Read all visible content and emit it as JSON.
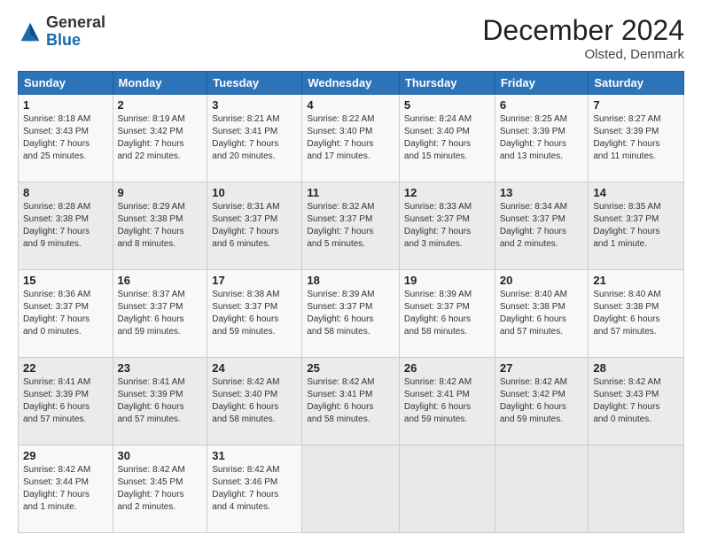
{
  "header": {
    "logo_general": "General",
    "logo_blue": "Blue",
    "month_title": "December 2024",
    "location": "Olsted, Denmark"
  },
  "days_of_week": [
    "Sunday",
    "Monday",
    "Tuesday",
    "Wednesday",
    "Thursday",
    "Friday",
    "Saturday"
  ],
  "weeks": [
    [
      {
        "day": "1",
        "info": "Sunrise: 8:18 AM\nSunset: 3:43 PM\nDaylight: 7 hours\nand 25 minutes."
      },
      {
        "day": "2",
        "info": "Sunrise: 8:19 AM\nSunset: 3:42 PM\nDaylight: 7 hours\nand 22 minutes."
      },
      {
        "day": "3",
        "info": "Sunrise: 8:21 AM\nSunset: 3:41 PM\nDaylight: 7 hours\nand 20 minutes."
      },
      {
        "day": "4",
        "info": "Sunrise: 8:22 AM\nSunset: 3:40 PM\nDaylight: 7 hours\nand 17 minutes."
      },
      {
        "day": "5",
        "info": "Sunrise: 8:24 AM\nSunset: 3:40 PM\nDaylight: 7 hours\nand 15 minutes."
      },
      {
        "day": "6",
        "info": "Sunrise: 8:25 AM\nSunset: 3:39 PM\nDaylight: 7 hours\nand 13 minutes."
      },
      {
        "day": "7",
        "info": "Sunrise: 8:27 AM\nSunset: 3:39 PM\nDaylight: 7 hours\nand 11 minutes."
      }
    ],
    [
      {
        "day": "8",
        "info": "Sunrise: 8:28 AM\nSunset: 3:38 PM\nDaylight: 7 hours\nand 9 minutes."
      },
      {
        "day": "9",
        "info": "Sunrise: 8:29 AM\nSunset: 3:38 PM\nDaylight: 7 hours\nand 8 minutes."
      },
      {
        "day": "10",
        "info": "Sunrise: 8:31 AM\nSunset: 3:37 PM\nDaylight: 7 hours\nand 6 minutes."
      },
      {
        "day": "11",
        "info": "Sunrise: 8:32 AM\nSunset: 3:37 PM\nDaylight: 7 hours\nand 5 minutes."
      },
      {
        "day": "12",
        "info": "Sunrise: 8:33 AM\nSunset: 3:37 PM\nDaylight: 7 hours\nand 3 minutes."
      },
      {
        "day": "13",
        "info": "Sunrise: 8:34 AM\nSunset: 3:37 PM\nDaylight: 7 hours\nand 2 minutes."
      },
      {
        "day": "14",
        "info": "Sunrise: 8:35 AM\nSunset: 3:37 PM\nDaylight: 7 hours\nand 1 minute."
      }
    ],
    [
      {
        "day": "15",
        "info": "Sunrise: 8:36 AM\nSunset: 3:37 PM\nDaylight: 7 hours\nand 0 minutes."
      },
      {
        "day": "16",
        "info": "Sunrise: 8:37 AM\nSunset: 3:37 PM\nDaylight: 6 hours\nand 59 minutes."
      },
      {
        "day": "17",
        "info": "Sunrise: 8:38 AM\nSunset: 3:37 PM\nDaylight: 6 hours\nand 59 minutes."
      },
      {
        "day": "18",
        "info": "Sunrise: 8:39 AM\nSunset: 3:37 PM\nDaylight: 6 hours\nand 58 minutes."
      },
      {
        "day": "19",
        "info": "Sunrise: 8:39 AM\nSunset: 3:37 PM\nDaylight: 6 hours\nand 58 minutes."
      },
      {
        "day": "20",
        "info": "Sunrise: 8:40 AM\nSunset: 3:38 PM\nDaylight: 6 hours\nand 57 minutes."
      },
      {
        "day": "21",
        "info": "Sunrise: 8:40 AM\nSunset: 3:38 PM\nDaylight: 6 hours\nand 57 minutes."
      }
    ],
    [
      {
        "day": "22",
        "info": "Sunrise: 8:41 AM\nSunset: 3:39 PM\nDaylight: 6 hours\nand 57 minutes."
      },
      {
        "day": "23",
        "info": "Sunrise: 8:41 AM\nSunset: 3:39 PM\nDaylight: 6 hours\nand 57 minutes."
      },
      {
        "day": "24",
        "info": "Sunrise: 8:42 AM\nSunset: 3:40 PM\nDaylight: 6 hours\nand 58 minutes."
      },
      {
        "day": "25",
        "info": "Sunrise: 8:42 AM\nSunset: 3:41 PM\nDaylight: 6 hours\nand 58 minutes."
      },
      {
        "day": "26",
        "info": "Sunrise: 8:42 AM\nSunset: 3:41 PM\nDaylight: 6 hours\nand 59 minutes."
      },
      {
        "day": "27",
        "info": "Sunrise: 8:42 AM\nSunset: 3:42 PM\nDaylight: 6 hours\nand 59 minutes."
      },
      {
        "day": "28",
        "info": "Sunrise: 8:42 AM\nSunset: 3:43 PM\nDaylight: 7 hours\nand 0 minutes."
      }
    ],
    [
      {
        "day": "29",
        "info": "Sunrise: 8:42 AM\nSunset: 3:44 PM\nDaylight: 7 hours\nand 1 minute."
      },
      {
        "day": "30",
        "info": "Sunrise: 8:42 AM\nSunset: 3:45 PM\nDaylight: 7 hours\nand 2 minutes."
      },
      {
        "day": "31",
        "info": "Sunrise: 8:42 AM\nSunset: 3:46 PM\nDaylight: 7 hours\nand 4 minutes."
      },
      null,
      null,
      null,
      null
    ]
  ]
}
